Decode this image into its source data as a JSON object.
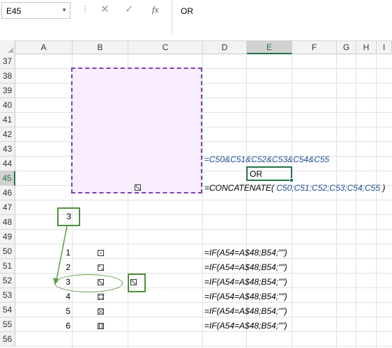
{
  "formula_bar": {
    "name_box": "E45",
    "name_box_arrow": "▼",
    "separator": "⋮",
    "cancel_glyph": "✕",
    "enter_glyph": "✓",
    "fx_label": "fx",
    "content": "OR"
  },
  "columns": [
    "A",
    "B",
    "C",
    "D",
    "E",
    "F",
    "G",
    "H",
    "I"
  ],
  "rows": [
    "37",
    "38",
    "39",
    "40",
    "41",
    "42",
    "43",
    "44",
    "45",
    "46",
    "47",
    "48",
    "49",
    "50",
    "51",
    "52",
    "53",
    "54",
    "55",
    "56"
  ],
  "selected": {
    "column": "E",
    "row": "45"
  },
  "cells": {
    "D44": "=C50&C51&C52&C53&C54&C55",
    "E45": "OR",
    "D46_prefix": "=CONCATENATE(",
    "D46_args": " C50;C51;C52;C53;C54;C55",
    "D46_suffix": " )",
    "A48": "3",
    "A50": "1",
    "A51": "2",
    "A52": "3",
    "A53": "4",
    "A54": "5",
    "A55": "6",
    "D50": "=IF(A54=A$48;B54;\"\")",
    "D51": "=IF(A54=A$48;B54;\"\")",
    "D52": "=IF(A54=A$48;B54;\"\")",
    "D53": "=IF(A54=A$48;B54;\"\")",
    "D54": "=IF(A54=A$48;B54;\"\")",
    "D55": "=IF(A54=A$48;B54;\"\")"
  },
  "dice_column_b": [
    1,
    2,
    3,
    4,
    5,
    6
  ],
  "die_c52": 3,
  "shape_die": 3,
  "colors": {
    "shape_fill": "#f8eefe",
    "shape_border": "#7a3fb8",
    "annotation_green": "#4e8f3a",
    "selection_green": "#217346",
    "formula_blue": "#1f4e96"
  }
}
